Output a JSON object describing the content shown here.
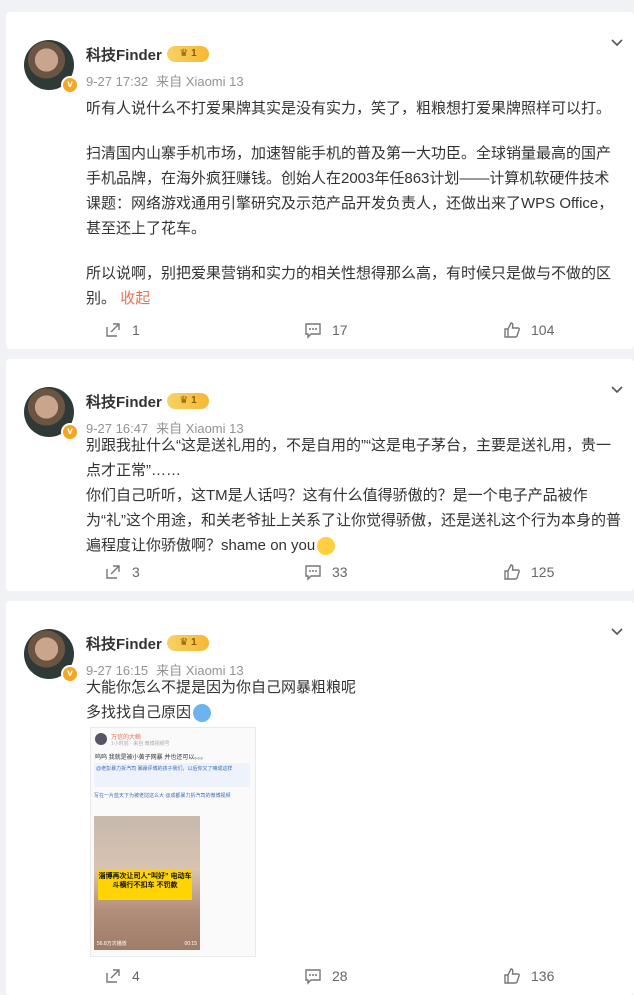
{
  "posts": [
    {
      "author": "科技Finder",
      "level": "1",
      "verified": "v",
      "time": "9-27 17:32",
      "source": "来自 Xiaomi 13",
      "paragraphs": [
        "听有人说什么不打爱果牌其实是没有实力，笑了，粗粮想打爱果牌照样可以打。",
        "扫清国内山寨手机市场，加速智能手机的普及第一大功臣。全球销量最高的国产手机品牌，在海外疯狂赚钱。创始人在2003年任863计划——计算机软硬件技术课题：网络游戏通用引擎研究及示范产品开发负责人，还做出来了WPS Office，甚至还上了花车。",
        "所以说啊，别把爱果营销和实力的相关性想得那么高，有时候只是做与不做的区别。"
      ],
      "collapse": "收起",
      "shares": "1",
      "comments": "17",
      "likes": "104"
    },
    {
      "author": "科技Finder",
      "level": "1",
      "verified": "v",
      "time": "9-27 16:47",
      "source": "来自 Xiaomi 13",
      "paragraphs": [
        "别跟我扯什么“这是送礼用的，不是自用的”“这是电子茅台，主要是送礼用，贵一点才正常”……",
        "你们自己听听，这TM是人话吗？这有什么值得骄傲的？是一个电子产品被作为“礼”这个用途，和关老爷扯上关系了让你觉得骄傲，还是送礼这个行为本身的普遍程度让你骄傲啊？shame on you"
      ],
      "shares": "3",
      "comments": "33",
      "likes": "125"
    },
    {
      "author": "科技Finder",
      "level": "1",
      "verified": "v",
      "time": "9-27 16:15",
      "source": "来自 Xiaomi 13",
      "paragraphs": [
        "大能你怎么不提是因为你自己网暴粗粮呢",
        "多找找自己原因"
      ],
      "embed": {
        "name": "万信的大鲸",
        "sub": "1小时前 · 来自 微博视频号",
        "line1": "呜呜 我就是被小黄子网暴 并也还可以。。。",
        "quote": "@老彭暴力拆汽司 暴躁评博的孩子我们，以后你又了嘛成这样",
        "quote2": "写在一片蓝天下为被老挝这么大 @成都暴力拆汽司的微博视频",
        "sticker": "淄博再次让司人“叫好” 电动车斗横行不扣车 不罚款",
        "views": "56.8万次播放",
        "duration": "00:15"
      },
      "shares": "4",
      "comments": "28",
      "likes": "136"
    }
  ],
  "colors": {
    "background": "#f1f2f5",
    "accent_link": "#eb7350",
    "meta_text": "#939393",
    "badge": "#f5a623"
  },
  "icons": {
    "share": "share-icon",
    "comment": "comment-icon",
    "like": "thumbs-up-icon",
    "menu": "chevron-down-icon"
  }
}
